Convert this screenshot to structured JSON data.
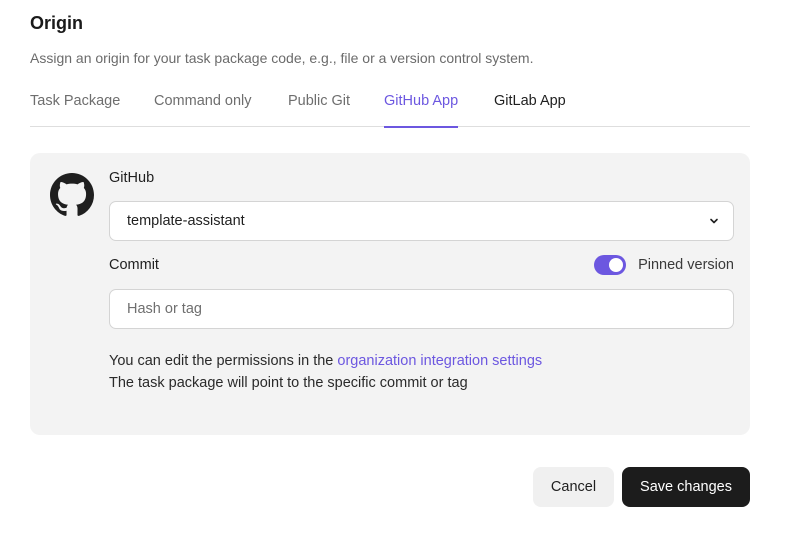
{
  "header": {
    "title": "Origin",
    "subtitle": "Assign an origin for your task package code, e.g., file or a version control system."
  },
  "tabs": [
    {
      "label": "Task Package",
      "active": false
    },
    {
      "label": "Command only",
      "active": false
    },
    {
      "label": "Public Git",
      "active": false
    },
    {
      "label": "GitHub App",
      "active": true
    },
    {
      "label": "GitLab App",
      "active": false
    }
  ],
  "panel": {
    "icon": "github-icon",
    "repo_label": "GitHub",
    "repo_value": "template-assistant",
    "commit_label": "Commit",
    "pinned_label": "Pinned version",
    "pinned_on": true,
    "commit_placeholder": "Hash or tag",
    "commit_value": "",
    "help_prefix": "You can edit the permissions in the ",
    "help_link": "organization integration settings",
    "help_line2": "The task package will point to the specific commit or tag"
  },
  "actions": {
    "cancel_label": "Cancel",
    "save_label": "Save changes"
  },
  "colors": {
    "accent": "#6c57e0",
    "primary_button": "#1c1c1c",
    "panel_bg": "#f3f3f3"
  }
}
